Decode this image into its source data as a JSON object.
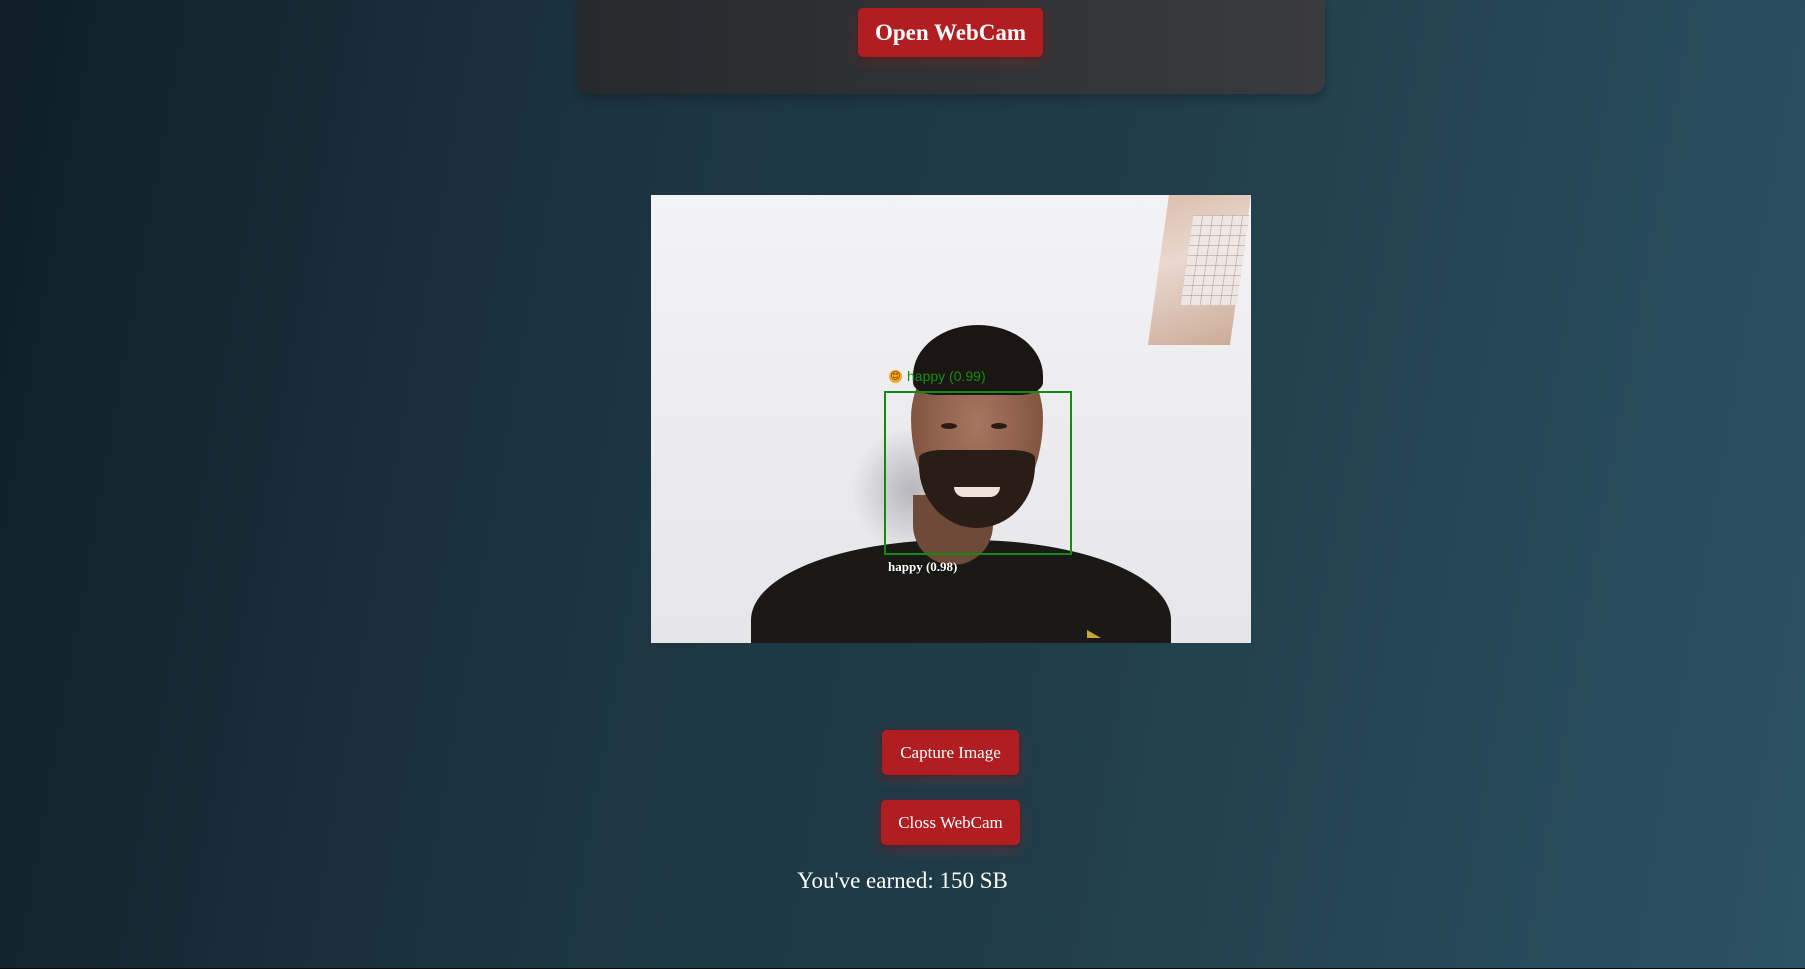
{
  "header": {
    "open_webcam_label": "Open WebCam"
  },
  "webcam": {
    "detection": {
      "emoji": "😊",
      "top_label": "happy (0.99)",
      "bottom_label": "happy (0.98)"
    },
    "box_color": "#138a13"
  },
  "actions": {
    "capture_label": "Capture Image",
    "close_label": "Closs WebCam"
  },
  "earned": {
    "text": "You've earned: 150 SB"
  },
  "colors": {
    "button_bg": "#b01e22",
    "panel_bg": "#2f3133"
  }
}
